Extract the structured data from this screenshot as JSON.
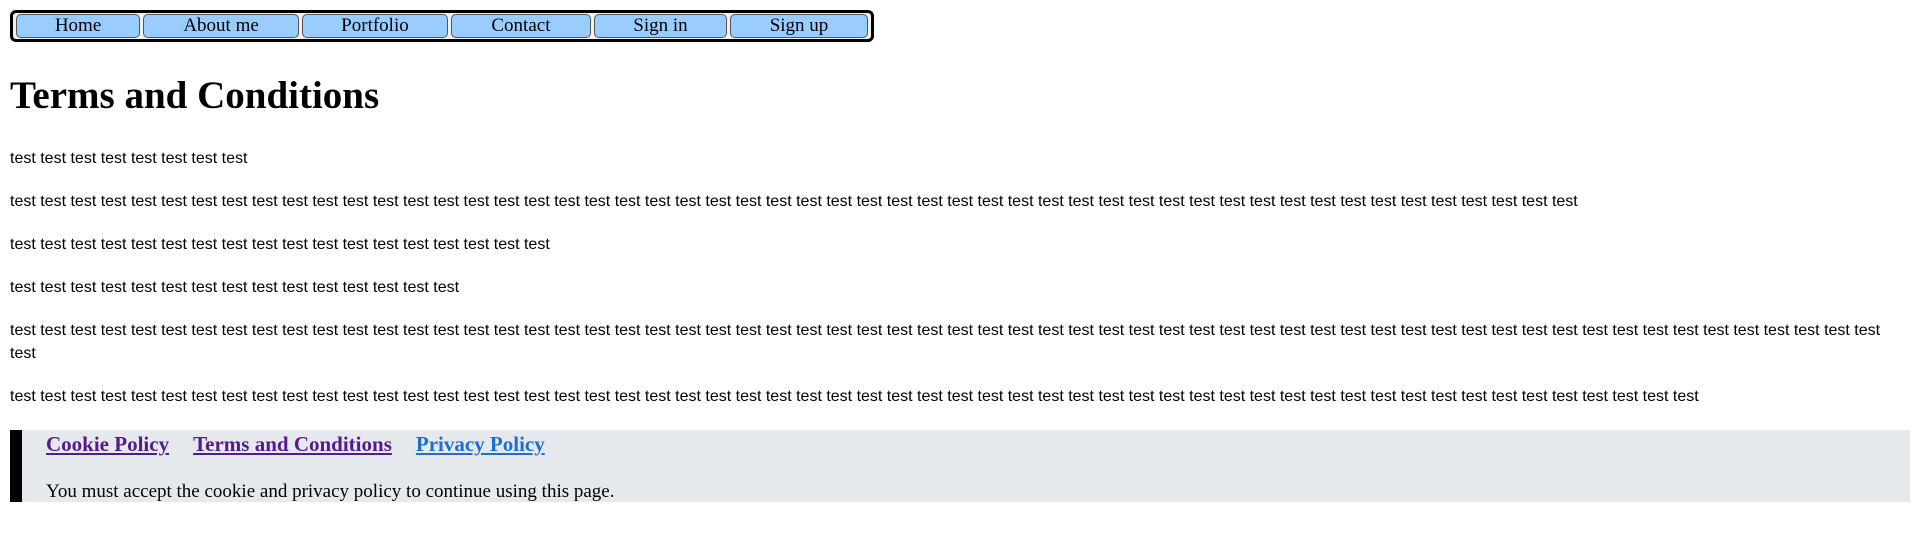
{
  "nav": {
    "items": [
      "Home",
      "About me",
      "Portfolio",
      "Contact",
      "Sign in",
      "Sign up"
    ]
  },
  "main": {
    "title": "Terms and Conditions",
    "paragraphs": [
      "test test test test test test test test",
      "test test test test test test test test test test test test test test test test test test test test test test test test test test test test test test test test test test test test test test test test test test test test test test test test test test test test",
      "test test test test test test test test test test test test test test test test test test",
      "test test test test test test test test test test test test test test test",
      "test test test test test test test test test test test test test test test test test test test test test test test test test test test test test test test test test test test test test test test test test test test test test test test test test test test test test test test test test test test test test test test",
      "test test test test test test test test test test test test test test test test test test test test test test test test test test test test test test test test test test test test test test test test test test test test test test test test test test test test test test test test"
    ]
  },
  "banner": {
    "links": [
      "Cookie Policy",
      "Terms and Conditions",
      "Privacy Policy"
    ],
    "message": "You must accept the cookie and privacy policy to continue using this page."
  }
}
